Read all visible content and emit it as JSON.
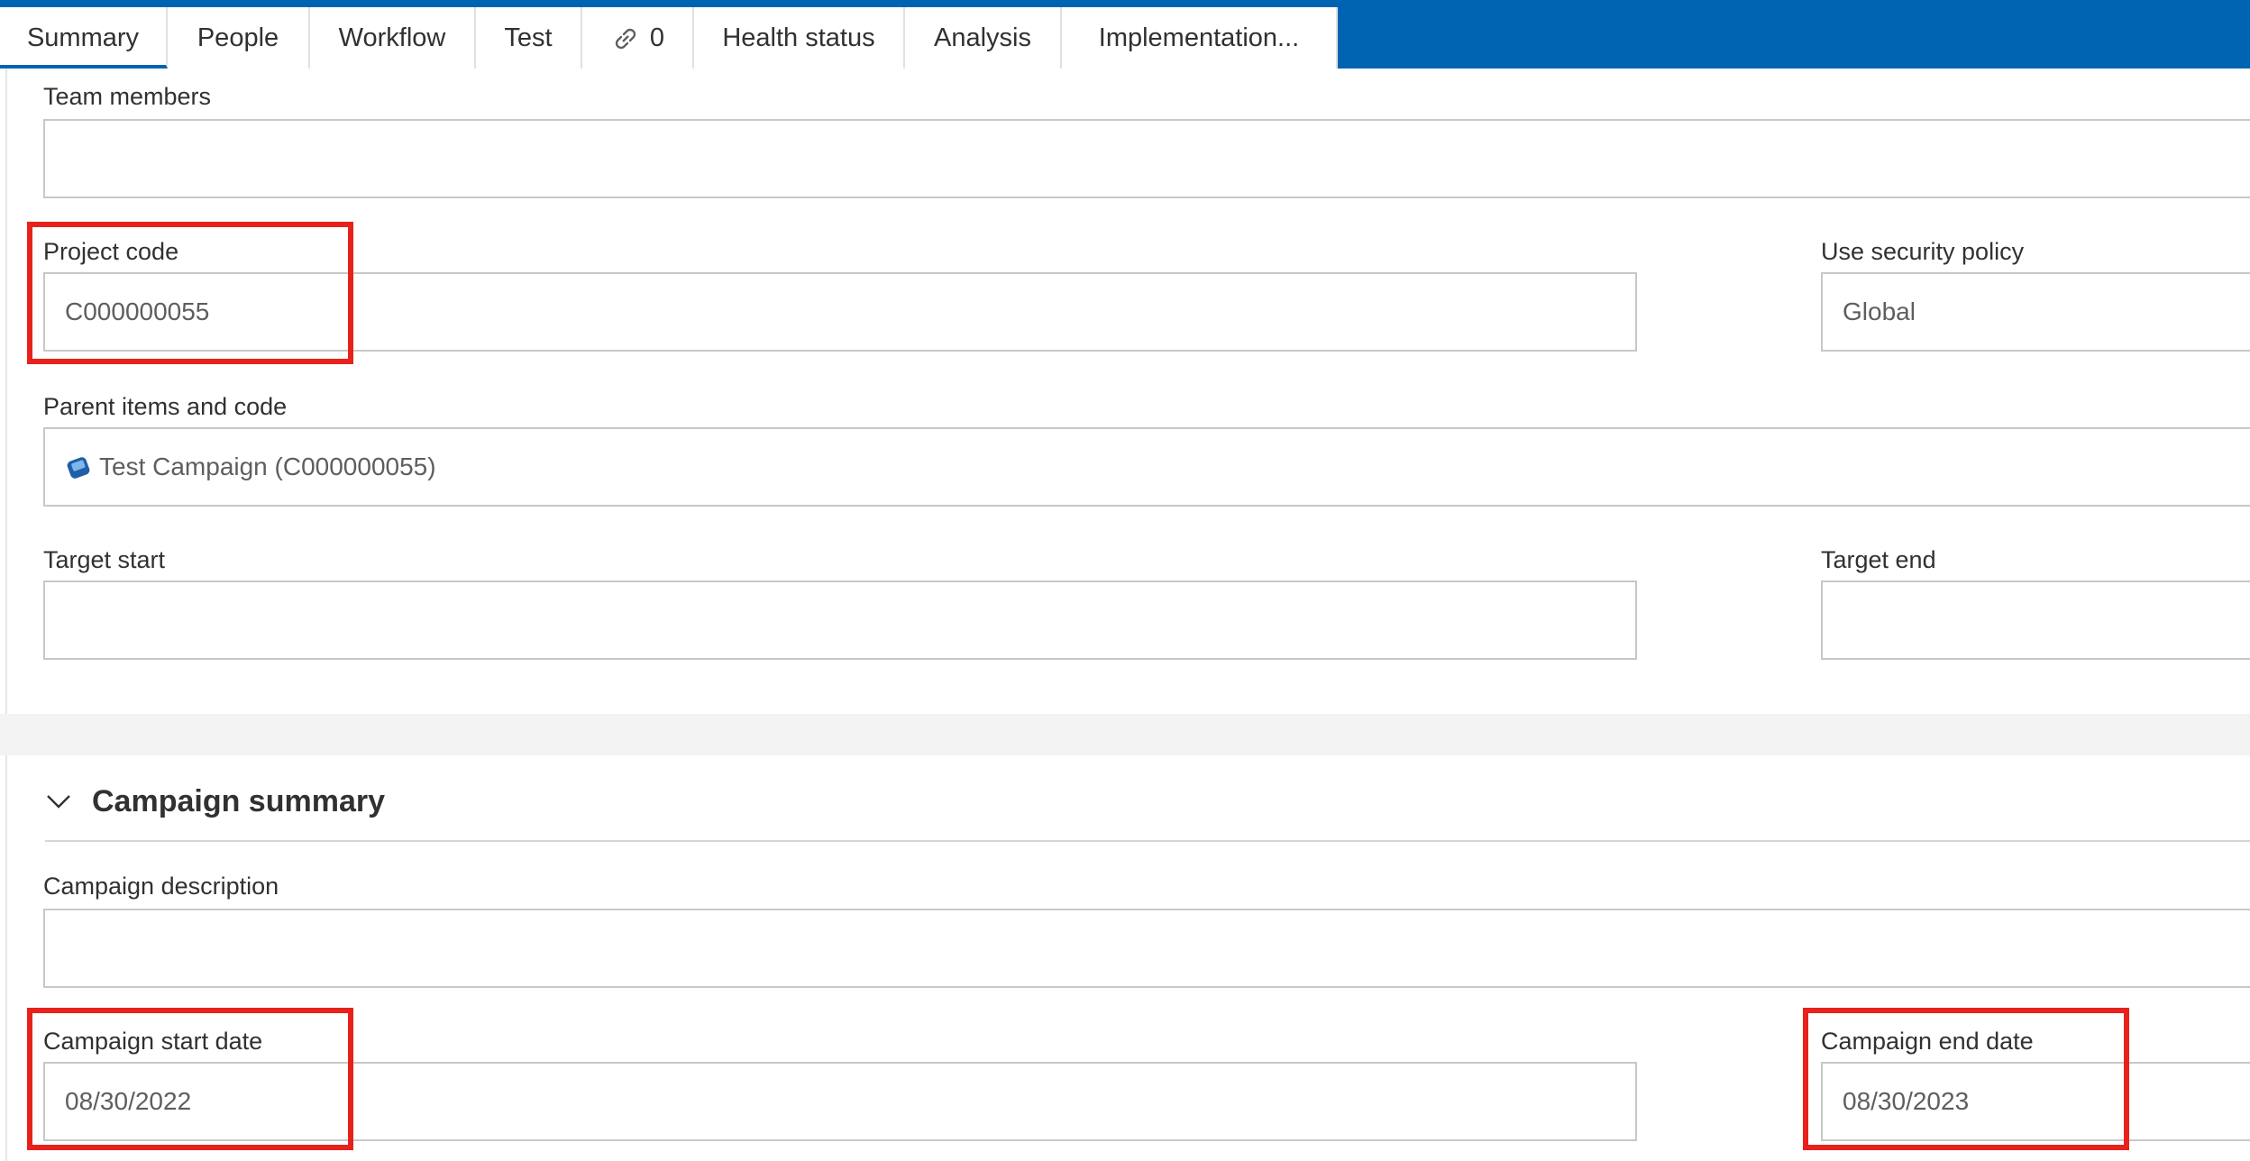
{
  "tabs": [
    {
      "label": "Summary"
    },
    {
      "label": "People"
    },
    {
      "label": "Workflow"
    },
    {
      "label": "Test"
    },
    {
      "label": "0"
    },
    {
      "label": "Health status"
    },
    {
      "label": "Analysis"
    },
    {
      "label": "Implementation..."
    }
  ],
  "fields": {
    "team_members": {
      "label": "Team members",
      "value": ""
    },
    "project_code": {
      "label": "Project code",
      "value": "C000000055"
    },
    "security_policy": {
      "label": "Use security policy",
      "value": "Global"
    },
    "parent_items": {
      "label": "Parent items and code",
      "value": "Test Campaign (C000000055)"
    },
    "target_start": {
      "label": "Target start",
      "value": ""
    },
    "target_end": {
      "label": "Target end",
      "value": ""
    }
  },
  "campaign_summary": {
    "title": "Campaign summary",
    "description": {
      "label": "Campaign description",
      "value": ""
    },
    "start_date": {
      "label": "Campaign start date",
      "value": "08/30/2022"
    },
    "end_date": {
      "label": "Campaign end date",
      "value": "08/30/2023"
    }
  },
  "colors": {
    "accent": "#0063b1",
    "highlight": "#e8221a"
  }
}
